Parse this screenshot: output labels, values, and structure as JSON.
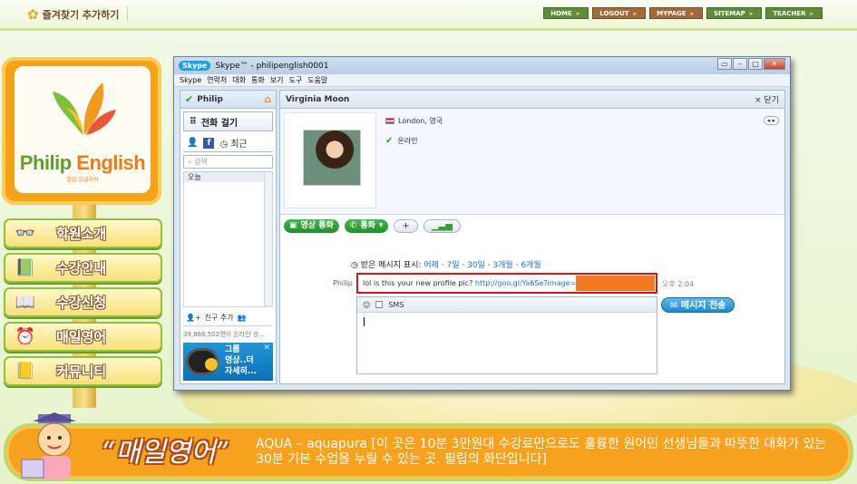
{
  "top": {
    "favorite": "즐겨찾기 추가하기",
    "nav": [
      "HOME",
      "LOGOUT",
      "MYPAGE",
      "SITEMAP",
      "TEACHER"
    ]
  },
  "logo": {
    "word1": "Philip",
    "word2": "English",
    "sub": "필립 잉글리쉬"
  },
  "menu": [
    "학원소개",
    "수강안내",
    "수강신청",
    "매일영어",
    "커뮤니티"
  ],
  "banner": {
    "title": "매일영어",
    "text": "AQUA – aquapura [이 곳은 10분 3만원대 수강료만으로도 훌륭한 원어민 선생님들과 따뜻한 대화가 있는 30분 기본 수업을 누릴 수 있는 곳. 필립의 화단입니다]"
  },
  "skype": {
    "window_title": "Skype™ - philipenglish0001",
    "logo": "Skype",
    "menubar": [
      "Skype",
      "연락처",
      "대화",
      "통화",
      "보기",
      "도구",
      "도움말"
    ],
    "left": {
      "user": "Philip",
      "call_phones": "전화 걸기",
      "recent_tab": "최근",
      "search_placeholder": "검색",
      "list_group": "오늘",
      "add_contact": "친구 추가",
      "online_count": "39,868,502명이 온라인 상...",
      "promo": [
        "그룹",
        "영상..더",
        "자세히..."
      ]
    },
    "chat": {
      "contact": "Virginia Moon",
      "close": "× 닫기",
      "location": "London, 영국",
      "status": "온라인",
      "video_call": "영상 통화",
      "call": "통화",
      "add": "+",
      "history_label": "받은 메시지 표시:",
      "history_links": [
        "어제",
        "7일",
        "30일",
        "3개월",
        "6개월"
      ],
      "sender": "Philip",
      "message": "lol is this your new profile pic?",
      "message_link": "http://goo.gl/Ya6Se?image=",
      "time": "오후 2:04",
      "sms": "SMS",
      "send": "메시지 전송"
    }
  }
}
